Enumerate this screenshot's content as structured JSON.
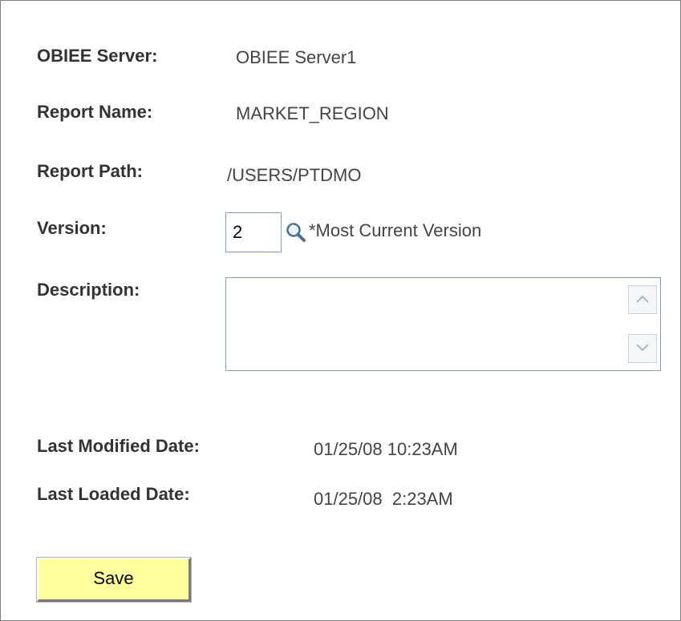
{
  "form": {
    "obiee_server": {
      "label": "OBIEE Server:",
      "value": "OBIEE Server1"
    },
    "report_name": {
      "label": "Report Name:",
      "value": "MARKET_REGION"
    },
    "report_path": {
      "label": "Report Path:",
      "value": "/USERS/PTDMO"
    },
    "version": {
      "label": "Version:",
      "value": "2",
      "lookup_icon": "magnifier-icon",
      "note": "*Most Current Version"
    },
    "description": {
      "label": "Description:",
      "value": ""
    },
    "last_modified": {
      "label": "Last Modified Date:",
      "value": "01/25/08 10:23AM"
    },
    "last_loaded": {
      "label": "Last Loaded Date:",
      "value": "01/25/08  2:23AM"
    }
  },
  "actions": {
    "save_label": "Save"
  },
  "colors": {
    "save_button_bg": "#ffff9c",
    "input_border": "#7f9db9"
  }
}
